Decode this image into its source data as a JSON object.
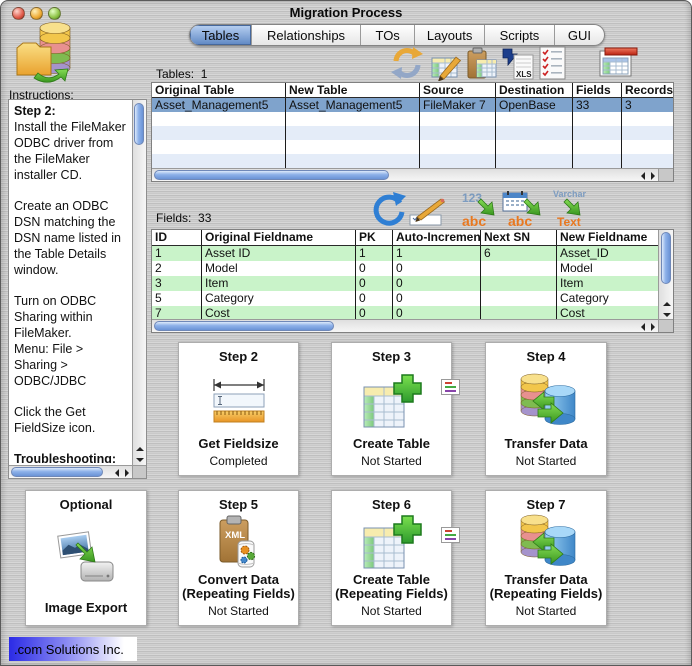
{
  "window": {
    "title": "Migration Process"
  },
  "tabs": {
    "selected": "Tables",
    "items": [
      {
        "label": "Tables"
      },
      {
        "label": "Relationships"
      },
      {
        "label": "TOs"
      },
      {
        "label": "Layouts"
      },
      {
        "label": "Scripts"
      },
      {
        "label": "GUI"
      }
    ]
  },
  "instructions": {
    "label": "Instructions:",
    "heading1": "Step 2:",
    "para1": "Install the FileMaker ODBC driver from the FileMaker installer CD.",
    "para2": "Create an ODBC DSN matching the DSN name listed in the Table Details window.",
    "para3": "Turn on ODBC Sharing within FileMaker.",
    "para4": "Menu: File > Sharing > ODBC/JDBC",
    "para5": "Click the Get FieldSize icon.",
    "heading2": "Troubleshooting:"
  },
  "tables_section": {
    "label": "Tables:",
    "count": "1",
    "columns": [
      "Original Table",
      "New Table",
      "Source",
      "Destination",
      "Fields",
      "Records"
    ],
    "rows": [
      [
        "Asset_Management5",
        "Asset_Management5",
        "FileMaker 7",
        "OpenBase",
        "33",
        "3"
      ]
    ]
  },
  "fields_section": {
    "label": "Fields:",
    "count": "33",
    "columns": [
      "ID",
      "Original Fieldname",
      "PK",
      "Auto-Increment",
      "Next SN",
      "New Fieldname"
    ],
    "rows": [
      [
        "1",
        "Asset ID",
        "1",
        "1",
        "6",
        "Asset_ID"
      ],
      [
        "2",
        "Model",
        "0",
        "0",
        "",
        "Model"
      ],
      [
        "3",
        "Item",
        "0",
        "0",
        "",
        "Item"
      ],
      [
        "5",
        "Category",
        "0",
        "0",
        "",
        "Category"
      ],
      [
        "7",
        "Cost",
        "0",
        "0",
        "",
        "Cost"
      ]
    ]
  },
  "icon_labels": {
    "xls": "XLS",
    "num": "123",
    "abc": "abc",
    "varchar": "Varchar",
    "text": "Text",
    "xml": "XML"
  },
  "icons": {
    "tables_toolbar": [
      "refresh-icon",
      "edit-table-icon",
      "paste-table-icon",
      "export-xls-icon",
      "checklist-icon",
      "table-details-icon"
    ],
    "fields_toolbar": [
      "refresh-fields-icon",
      "edit-field-icon",
      "number-to-text-icon",
      "date-to-text-icon",
      "varchar-to-text-icon"
    ],
    "app_logo": "database-folder-icon"
  },
  "steps": [
    {
      "title": "Step 2",
      "name": "Get Fieldsize",
      "subname": "",
      "status": "Completed"
    },
    {
      "title": "Step 3",
      "name": "Create Table",
      "subname": "",
      "status": "Not Started"
    },
    {
      "title": "Step 4",
      "name": "Transfer Data",
      "subname": "",
      "status": "Not Started"
    },
    {
      "title": "Optional",
      "name": "Image Export",
      "subname": "",
      "status": ""
    },
    {
      "title": "Step 5",
      "name": "Convert Data",
      "subname": "(Repeating Fields)",
      "status": "Not Started"
    },
    {
      "title": "Step 6",
      "name": "Create Table",
      "subname": "(Repeating Fields)",
      "status": "Not Started"
    },
    {
      "title": "Step 7",
      "name": "Transfer Data",
      "subname": "(Repeating Fields)",
      "status": "Not Started"
    }
  ],
  "footer": {
    "brand": ".com Solutions Inc."
  },
  "colors": {
    "selected_row": "#7fa3cc",
    "field_row_green": "#c9f3c9",
    "row_alt_blue": "#e4ecf8",
    "tab_selected": "#5e87c3",
    "brand_blue": "#2b2be6",
    "status_plus_green": "#2d9a2d",
    "accent_orange": "#e87820",
    "accent_blue_text": "#7d9cc0"
  }
}
